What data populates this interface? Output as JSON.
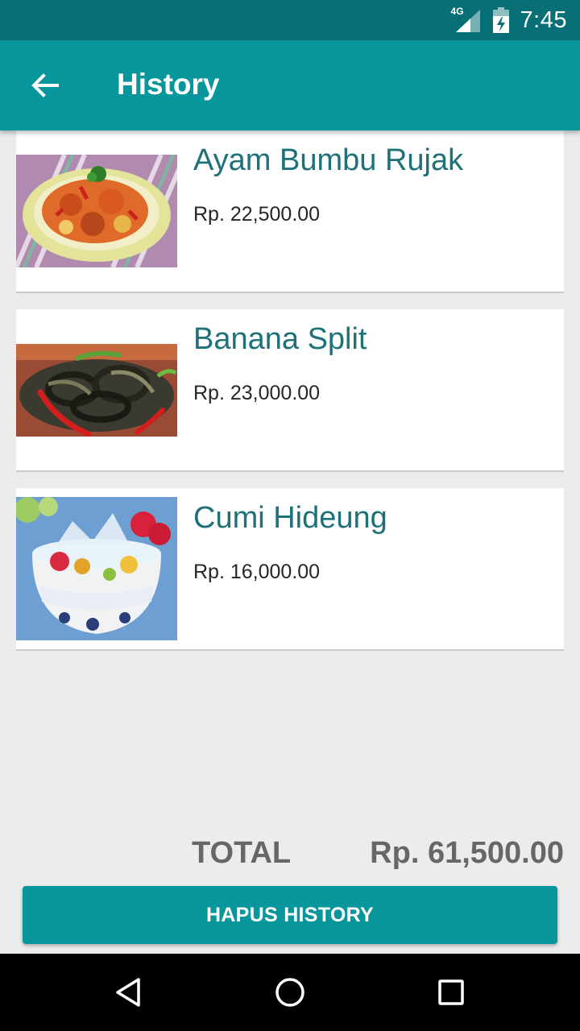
{
  "status_bar": {
    "network": "4G",
    "time": "7:45"
  },
  "app_bar": {
    "title": "History",
    "back_icon": "arrow-back-icon"
  },
  "history": {
    "items": [
      {
        "name": "Ayam Bumbu Rujak",
        "price": "Rp. 22,500.00",
        "image": "chicken-dish-photo"
      },
      {
        "name": "Banana Split",
        "price": "Rp. 23,000.00",
        "image": "squid-dish-photo"
      },
      {
        "name": "Cumi Hideung",
        "price": "Rp. 16,000.00",
        "image": "fruit-ice-dessert-photo"
      }
    ]
  },
  "total": {
    "label": "TOTAL",
    "value": "Rp. 61,500.00"
  },
  "actions": {
    "clear_label": "HAPUS HISTORY"
  },
  "nav": {
    "back_icon": "nav-back-icon",
    "home_icon": "nav-home-icon",
    "recents_icon": "nav-recents-icon"
  },
  "colors": {
    "status_bar": "#086f76",
    "primary": "#07969c",
    "item_name": "#1e7079",
    "background": "#ececec"
  }
}
